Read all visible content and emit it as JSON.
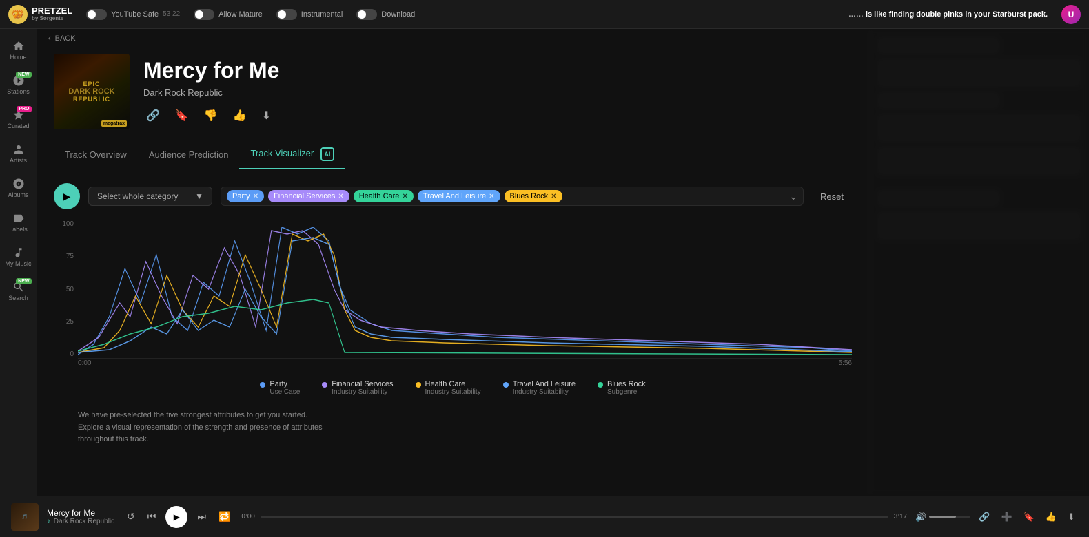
{
  "app": {
    "name": "PRETZEL",
    "tagline": "by Sorgente"
  },
  "top_bar": {
    "toggles": [
      {
        "id": "youtube-safe",
        "label": "YouTube Safe",
        "value": "53 22",
        "on": false
      },
      {
        "id": "allow-mature",
        "label": "Allow Mature",
        "on": false
      },
      {
        "id": "instrumental",
        "label": "Instrumental",
        "on": false
      },
      {
        "id": "download",
        "label": "Download",
        "on": false
      }
    ],
    "message": "is like finding double pinks in your Starburst pack.",
    "youtube_count": "53 22"
  },
  "sidebar": {
    "items": [
      {
        "id": "home",
        "label": "Home",
        "icon": "home"
      },
      {
        "id": "stations",
        "label": "Stations",
        "icon": "stations",
        "badge": "NEW",
        "badge_type": "new"
      },
      {
        "id": "curated",
        "label": "Curated",
        "icon": "curated",
        "badge": "PRO",
        "badge_type": "pro"
      },
      {
        "id": "artists",
        "label": "Artists",
        "icon": "artists"
      },
      {
        "id": "albums",
        "label": "Albums",
        "icon": "albums"
      },
      {
        "id": "labels",
        "label": "Labels",
        "icon": "labels"
      },
      {
        "id": "my-music",
        "label": "My Music",
        "icon": "my-music"
      },
      {
        "id": "search",
        "label": "Search",
        "icon": "search",
        "badge": "NEW",
        "badge_type": "new"
      }
    ]
  },
  "back_label": "BACK",
  "track": {
    "title": "Mercy for Me",
    "artist": "Dark Rock Republic",
    "artwork_line1": "epic",
    "artwork_line2": "DARK ROCK",
    "artwork_line3": "republic",
    "artwork_label": "megatrax"
  },
  "actions": {
    "link": "link",
    "bookmark": "bookmark",
    "dislike": "dislike",
    "like": "like",
    "download": "download"
  },
  "tabs": [
    {
      "id": "track-overview",
      "label": "Track Overview",
      "active": false
    },
    {
      "id": "audience-prediction",
      "label": "Audience Prediction",
      "active": false
    },
    {
      "id": "track-visualizer",
      "label": "Track Visualizer",
      "active": true
    }
  ],
  "visualizer": {
    "category_placeholder": "Select whole category",
    "tags": [
      {
        "id": "party",
        "label": "Party",
        "class": "party"
      },
      {
        "id": "financial-services",
        "label": "Financial Services",
        "class": "financial"
      },
      {
        "id": "health-care",
        "label": "Health Care",
        "class": "healthcare"
      },
      {
        "id": "travel-and-leisure",
        "label": "Travel And Leisure",
        "class": "travel"
      },
      {
        "id": "blues-rock",
        "label": "Blues Rock",
        "class": "bluesrock"
      }
    ],
    "reset_label": "Reset",
    "y_labels": [
      "100",
      "75",
      "50",
      "25",
      "0"
    ],
    "time_labels": [
      "0:00",
      "5:56"
    ],
    "legend": [
      {
        "id": "party",
        "label": "Party",
        "sub": "Use Case",
        "color": "#5b9cf6"
      },
      {
        "id": "financial-services",
        "label": "Financial Services",
        "sub": "Industry Suitability",
        "color": "#a78bfa"
      },
      {
        "id": "health-care",
        "label": "Health Care",
        "sub": "Industry Suitability",
        "color": "#fbbf24"
      },
      {
        "id": "travel-and-leisure",
        "label": "Travel And Leisure",
        "sub": "Industry Suitability",
        "color": "#60a5fa"
      },
      {
        "id": "blues-rock",
        "label": "Blues Rock",
        "sub": "Subgenre",
        "color": "#34d399"
      }
    ],
    "info_line1": "We have pre-selected the five strongest attributes to get you started.",
    "info_line2": "Explore a visual representation of the strength and presence of attributes",
    "info_line3": "throughout this track."
  },
  "player": {
    "track_title": "Mercy for Me",
    "track_artist": "Dark Rock Republic",
    "time_current": "0:00",
    "time_total": "3:17",
    "volume_pct": 65,
    "progress_pct": 0
  }
}
